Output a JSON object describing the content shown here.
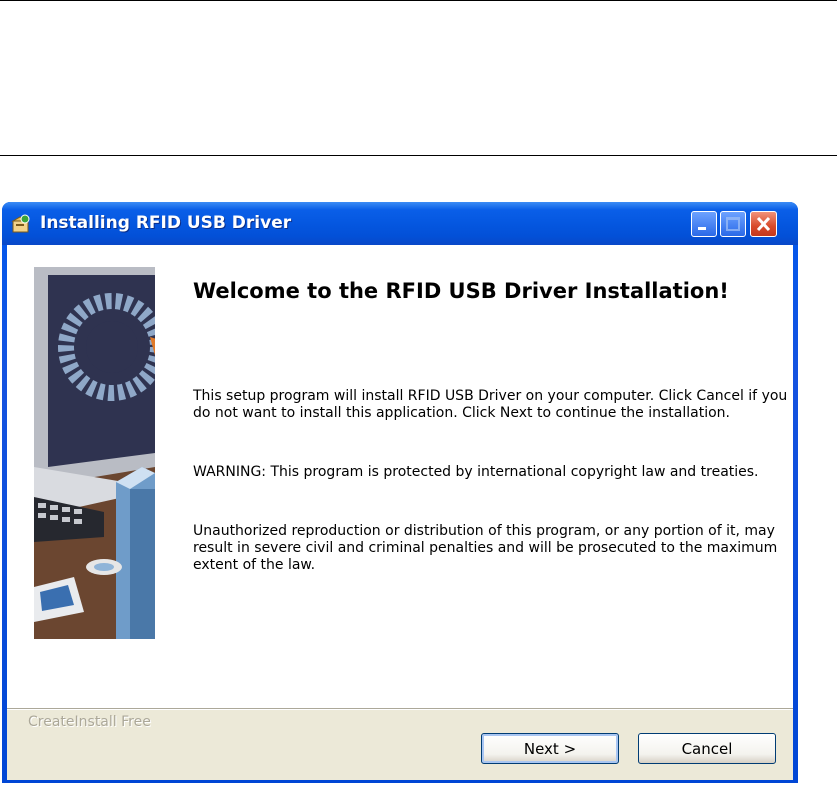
{
  "window": {
    "title": "Installing RFID USB Driver",
    "icon": "installer-icon",
    "controls": [
      "minimize-icon",
      "maximize-icon",
      "close-icon"
    ]
  },
  "content": {
    "headline": "Welcome to the RFID USB Driver Installation!",
    "paragraph_1": "This setup program will install RFID USB Driver on your computer. Click Cancel if you do not want to install this application. Click Next to continue the installation.",
    "paragraph_2": "WARNING: This program is protected by international copyright law and treaties.",
    "paragraph_3": "Unauthorized reproduction or distribution of this program, or any portion of it, may result in severe civil and criminal penalties and will be prosecuted to the maximum extent of the law."
  },
  "footer": {
    "brand": "CreateInstall Free",
    "next_label": "Next >",
    "cancel_label": "Cancel"
  },
  "colors": {
    "titlebar": "#0557e0",
    "footer_bg": "#ece9d8",
    "close_button": "#d84a2a"
  }
}
